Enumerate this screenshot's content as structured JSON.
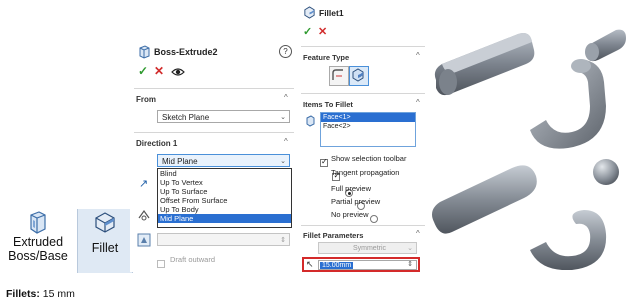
{
  "toolbar": {
    "extruded_label_line1": "Extruded",
    "extruded_label_line2": "Boss/Base",
    "fillet_label": "Fillet"
  },
  "boss_panel": {
    "title": "Boss-Extrude2",
    "help_glyph": "?",
    "from_label": "From",
    "from_value": "Sketch Plane",
    "direction_label": "Direction 1",
    "direction_value": "Mid Plane",
    "direction_options": [
      "Blind",
      "Up To Vertex",
      "Up To Surface",
      "Offset From Surface",
      "Up To Body",
      "Mid Plane"
    ],
    "draft_label": "Draft outward"
  },
  "fillet_panel": {
    "title": "Fillet1",
    "feature_type_label": "Feature Type",
    "items_label": "Items To Fillet",
    "items": [
      "Face<1>",
      "Face<2>"
    ],
    "options": {
      "show_selection_toolbar": "Show selection toolbar",
      "tangent_propagation": "Tangent propagation",
      "full_preview": "Full preview",
      "partial_preview": "Partial preview",
      "no_preview": "No preview"
    },
    "params_label": "Fillet Parameters",
    "symmetric_value": "Symmetric",
    "radius_value": "15.00mm"
  },
  "footnote": {
    "label": "Fillets:",
    "value": "15 mm"
  },
  "colors": {
    "highlight": "#2a6fd1",
    "accept_green": "#2f9a2f",
    "cancel_red": "#d12b2b",
    "focus_red": "#d42a2a"
  }
}
